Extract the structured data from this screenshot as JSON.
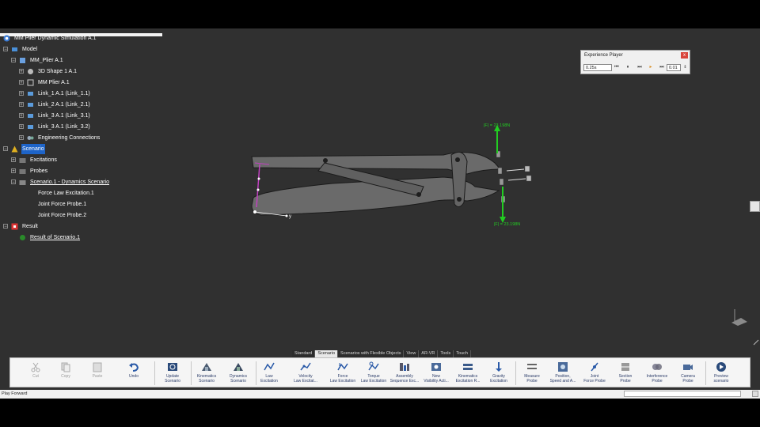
{
  "tree": {
    "root": "MM Plier Dynamic Simulation A.1",
    "model": "Model",
    "product": "MM_Plier A.1",
    "children": [
      "3D Shape 1 A.1",
      "MM Plier A.1",
      "Link_1 A.1 (Link_1.1)",
      "Link_2 A.1 (Link_2.1)",
      "Link_3 A.1 (Link_3.1)",
      "Link_3 A.1 (Link_3.2)",
      "Engineering Connections"
    ],
    "scenario": "Scenario",
    "excitations": "Excitations",
    "probes": "Probes",
    "dynamics_scenario": "Scenario.1 - Dynamics Scenario",
    "scenario_items": [
      "Force Law Excitation.1",
      "Joint Force Probe.1",
      "Joint Force Probe.2"
    ],
    "result": "Result",
    "result_item": "Result of Scenario.1"
  },
  "player": {
    "title": "Experience Player",
    "close": "x",
    "time": "0.25s",
    "step": "0.01",
    "buttons": [
      "⏮",
      "⏸",
      "⏭",
      "▸",
      "⏭"
    ]
  },
  "scene": {
    "force_top": "|F| = 23.198N",
    "force_bottom": "|F| = 23.198N",
    "axis_x": "x",
    "axis_y": "y",
    "force_color": "#22cc22",
    "excitation_color": "#c040c0"
  },
  "tabs": [
    "Standard",
    "Scenario",
    "Scenarios with Flexible Objects",
    "View",
    "AR-VR",
    "Tools",
    "Touch"
  ],
  "active_tab": "Scenario",
  "toolbar": [
    {
      "label": "Cut",
      "disabled": true
    },
    {
      "label": "Copy",
      "disabled": true
    },
    {
      "label": "Paste",
      "disabled": true
    },
    {
      "label": "Undo",
      "disabled": false
    },
    {
      "label": "Update\nScenario",
      "disabled": false
    },
    {
      "label": "Kinematics\nScenario",
      "disabled": false
    },
    {
      "label": "Dynamics\nScenario",
      "disabled": false
    },
    {
      "label": "Law\nExcitation",
      "disabled": false
    },
    {
      "label": "Velocity\nLaw Excitat...",
      "disabled": false
    },
    {
      "label": "Force\nLaw Excitation",
      "disabled": false
    },
    {
      "label": "Torque\nLaw Excitation",
      "disabled": false
    },
    {
      "label": "Assembly\nSequence Exc...",
      "disabled": false
    },
    {
      "label": "New\nVisibility Acti...",
      "disabled": false
    },
    {
      "label": "Kinematics\nExcitation R...",
      "disabled": false
    },
    {
      "label": "Gravity\nExcitation",
      "disabled": false
    },
    {
      "label": "Measure\nProbe",
      "disabled": false
    },
    {
      "label": "Position,\nSpeed and A...",
      "disabled": false
    },
    {
      "label": "Joint\nForce Probe",
      "disabled": false
    },
    {
      "label": "Section\nProbe",
      "disabled": false
    },
    {
      "label": "Interference\nProbe",
      "disabled": false
    },
    {
      "label": "Camera\nProbe",
      "disabled": false
    },
    {
      "label": "Preview\nscenario",
      "disabled": false
    }
  ],
  "status": {
    "text": "Play Forward"
  }
}
